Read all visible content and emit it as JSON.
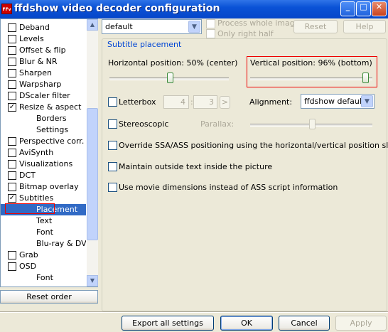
{
  "window": {
    "title": "ffdshow video decoder configuration",
    "icon_text": "FFv",
    "minimize_label": "_",
    "maximize_label": "□",
    "close_label": "✕"
  },
  "tree": {
    "items": [
      {
        "label": "Deband",
        "checked": false,
        "sub": false
      },
      {
        "label": "Levels",
        "checked": false,
        "sub": false
      },
      {
        "label": "Offset & flip",
        "checked": false,
        "sub": false
      },
      {
        "label": "Blur & NR",
        "checked": false,
        "sub": false
      },
      {
        "label": "Sharpen",
        "checked": false,
        "sub": false
      },
      {
        "label": "Warpsharp",
        "checked": false,
        "sub": false
      },
      {
        "label": "DScaler filter",
        "checked": false,
        "sub": false
      },
      {
        "label": "Resize & aspect",
        "checked": true,
        "sub": false
      },
      {
        "label": "Borders",
        "sub": true
      },
      {
        "label": "Settings",
        "sub": true
      },
      {
        "label": "Perspective corr.",
        "checked": false,
        "sub": false
      },
      {
        "label": "AviSynth",
        "checked": false,
        "sub": false
      },
      {
        "label": "Visualizations",
        "checked": false,
        "sub": false
      },
      {
        "label": "DCT",
        "checked": false,
        "sub": false
      },
      {
        "label": "Bitmap overlay",
        "checked": false,
        "sub": false
      },
      {
        "label": "Subtitles",
        "checked": true,
        "sub": false
      },
      {
        "label": "Placement",
        "sub": true,
        "selected": true
      },
      {
        "label": "Text",
        "sub": true
      },
      {
        "label": "Font",
        "sub": true
      },
      {
        "label": "Blu-ray & DVD",
        "sub": true
      },
      {
        "label": "Grab",
        "checked": false,
        "sub": false
      },
      {
        "label": "OSD",
        "checked": false,
        "sub": false
      },
      {
        "label": "Font",
        "sub": true
      }
    ],
    "check_mark": "✓",
    "scroll_up": "▲",
    "scroll_down": "▼"
  },
  "left_bottom": {
    "reset_order": "Reset order"
  },
  "top": {
    "preset_value": "default",
    "preset_arrow": "▼",
    "process_whole_image": "Process whole image",
    "only_right_half": "Only right half",
    "reset": "Reset",
    "help": "Help"
  },
  "placement": {
    "group_title": "Subtitle placement",
    "horizontal_label": "Horizontal position:",
    "horizontal_value": "50% (center)",
    "horizontal_level": 0.5,
    "vertical_label": "Vertical position:",
    "vertical_value": "96% (bottom)",
    "vertical_level": 0.96,
    "letterbox": "Letterbox",
    "letterbox_x": "4",
    "letterbox_sep": ":",
    "letterbox_y": "3",
    "letterbox_btn": ">",
    "alignment_label": "Alignment:",
    "alignment_value": "ffdshow default",
    "stereoscopic": "Stereoscopic",
    "parallax": "Parallax:",
    "parallax_level": 0.5,
    "override_ssa": "Override SSA/ASS positioning using the horizontal/vertical position sliders",
    "maintain_outside": "Maintain outside text inside the picture",
    "movie_dimensions": "Use movie dimensions instead of ASS script information"
  },
  "bottom": {
    "export": "Export all settings",
    "ok": "OK",
    "cancel": "Cancel",
    "apply": "Apply"
  },
  "colors": {
    "title_bar": "#0a52d6",
    "selection": "#316ac5",
    "highlight_box": "#e00000",
    "group_title": "#0046d5"
  }
}
